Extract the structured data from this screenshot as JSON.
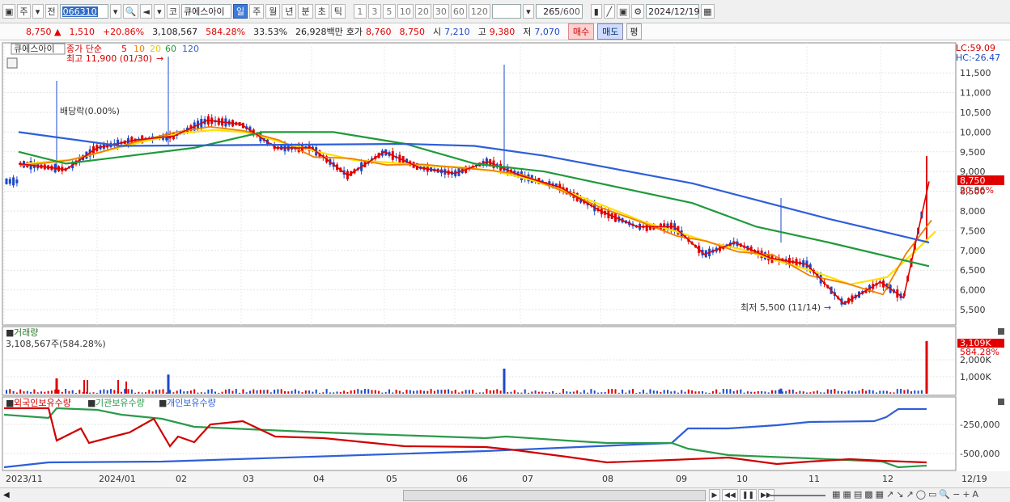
{
  "toolbar": {
    "market_label": "주",
    "prev_label": "전",
    "stock_code": "066310",
    "code_label": "코",
    "stock_name": "큐에스아이",
    "periods": [
      "일",
      "주",
      "월",
      "년",
      "분",
      "초",
      "틱"
    ],
    "active_period": "일",
    "intervals": [
      "1",
      "3",
      "5",
      "10",
      "20",
      "30",
      "60",
      "120"
    ],
    "count": "265",
    "count_total": "/600",
    "date": "2024/12/19"
  },
  "price": {
    "current": "8,750",
    "change": "1,510",
    "change_pct": "+20.86%",
    "volume": "3,108,567",
    "volume_ratio": "584.28%",
    "turnover": "33.53%",
    "amount": "26,928백만",
    "quote_label": "호가",
    "ask": "8,760",
    "bid": "8,750",
    "open_label": "시",
    "open": "7,210",
    "high_label": "고",
    "high": "9,380",
    "low_label": "저",
    "low": "7,070",
    "buy_label": "매수",
    "sell_label": "매도",
    "eval_label": "평"
  },
  "main_panel": {
    "stock_tag": "큐에스아이",
    "legend_price": "종가 단순",
    "ma_periods": [
      "5",
      "10",
      "20",
      "60",
      "120"
    ],
    "lc_label": "LC:59.09",
    "hc_label": "HC:-26.47",
    "high_annotation": "최고 11,900 (01/30)",
    "low_annotation": "최저 5,500 (11/14)",
    "dividend_annotation": "배당락(0.00%)",
    "last_price_tag": "8,750",
    "last_pct_tag": "20.86%"
  },
  "volume_panel": {
    "title": "거래량",
    "info": "3,108,567주(584.28%)",
    "last_tag": "3,109K",
    "last_pct": "584.28%"
  },
  "holdings_panel": {
    "legend": [
      "외국인보유수량",
      "기관보유수량",
      "개인보유수량"
    ]
  },
  "x_axis": {
    "labels": [
      "2023/11",
      "2024/01",
      "02",
      "03",
      "04",
      "05",
      "06",
      "07",
      "08",
      "09",
      "10",
      "11",
      "12"
    ],
    "right_label": "12/19"
  },
  "colors": {
    "up": "#e00000",
    "down": "#1b49c8",
    "ma5": "#e00000",
    "ma10": "#f08000",
    "ma20": "#ffe000",
    "ma60": "#1f9a3a",
    "ma120": "#2e5fd8",
    "foreign": "#d00000",
    "institution": "#2a9a4a",
    "individual": "#2e5fd8"
  },
  "chart_data": {
    "type": "line",
    "y_price_ticks": [
      "11,500",
      "11,000",
      "10,500",
      "10,000",
      "9,500",
      "9,000",
      "8,500",
      "8,000",
      "7,500",
      "7,000",
      "6,500",
      "6,000",
      "5,500"
    ],
    "y_volume_ticks": [
      "2,000K",
      "1,000K"
    ],
    "y_holdings_ticks": [
      "-250,000",
      "-500,000"
    ],
    "close_trace": [
      [
        "2023/11",
        9200
      ],
      [
        "2023/12",
        9050
      ],
      [
        "2024/01",
        9600
      ],
      [
        "2024/01",
        9800
      ],
      [
        "2024/02",
        9900
      ],
      [
        "2024/02",
        10300
      ],
      [
        "2024/03",
        10200
      ],
      [
        "2024/03",
        9600
      ],
      [
        "2024/04",
        9600
      ],
      [
        "2024/04",
        8900
      ],
      [
        "2024/05",
        9500
      ],
      [
        "2024/05",
        9100
      ],
      [
        "2024/06",
        8950
      ],
      [
        "2024/06",
        9250
      ],
      [
        "2024/07",
        8900
      ],
      [
        "2024/07",
        8600
      ],
      [
        "2024/08",
        8000
      ],
      [
        "2024/08",
        7600
      ],
      [
        "2024/09",
        7600
      ],
      [
        "2024/09",
        6900
      ],
      [
        "2024/10",
        7200
      ],
      [
        "2024/10",
        6800
      ],
      [
        "2024/11",
        6650
      ],
      [
        "2024/11",
        5650
      ],
      [
        "2024/12",
        6200
      ],
      [
        "2024/12",
        5800
      ],
      [
        "2024/12/19",
        8750
      ]
    ],
    "ma120_trace": [
      [
        "2023/11",
        10000
      ],
      [
        "2024/01",
        9650
      ],
      [
        "2024/05",
        9700
      ],
      [
        "2024/06",
        9650
      ],
      [
        "2024/07",
        9400
      ],
      [
        "2024/09",
        8700
      ],
      [
        "2024/11",
        7800
      ],
      [
        "2024/12/19",
        7200
      ]
    ],
    "ma60_trace": [
      [
        "2023/11",
        9500
      ],
      [
        "2023/12",
        9200
      ],
      [
        "2024/02",
        9600
      ],
      [
        "2024/03",
        10000
      ],
      [
        "2024/04",
        10000
      ],
      [
        "2024/05",
        9700
      ],
      [
        "2024/06",
        9200
      ],
      [
        "2024/07",
        9000
      ],
      [
        "2024/09",
        8200
      ],
      [
        "2024/10",
        7600
      ],
      [
        "2024/11",
        7200
      ],
      [
        "2024/12/19",
        6600
      ]
    ],
    "volume_spikes": [
      {
        "date": "2023/12",
        "value": 900
      },
      {
        "date": "2024/01/30",
        "value": 1130
      },
      {
        "date": "2024/06",
        "value": 1480
      },
      {
        "date": "2024/10",
        "value": 300
      },
      {
        "date": "2024/12/19",
        "value": 3109
      }
    ]
  }
}
